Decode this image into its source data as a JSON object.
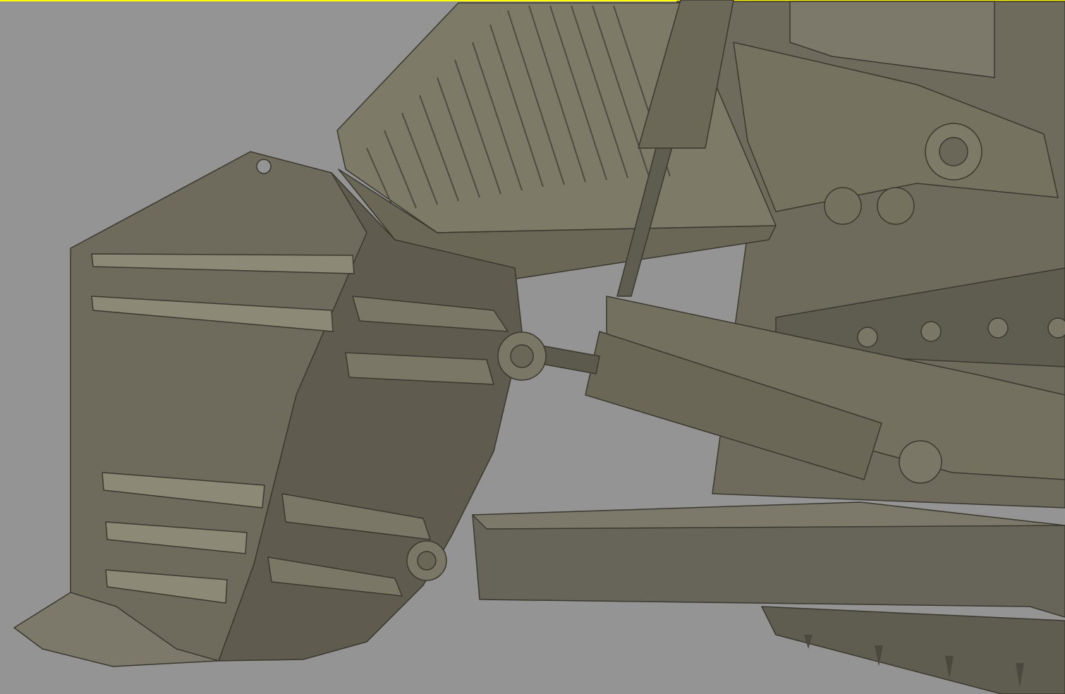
{
  "viewport": {
    "background_color": "#949494",
    "active_border_color": "#ffff00"
  },
  "model": {
    "base_color": "#6e6b5c",
    "highlight_color": "#8c8977",
    "shadow_color": "#56544a"
  }
}
